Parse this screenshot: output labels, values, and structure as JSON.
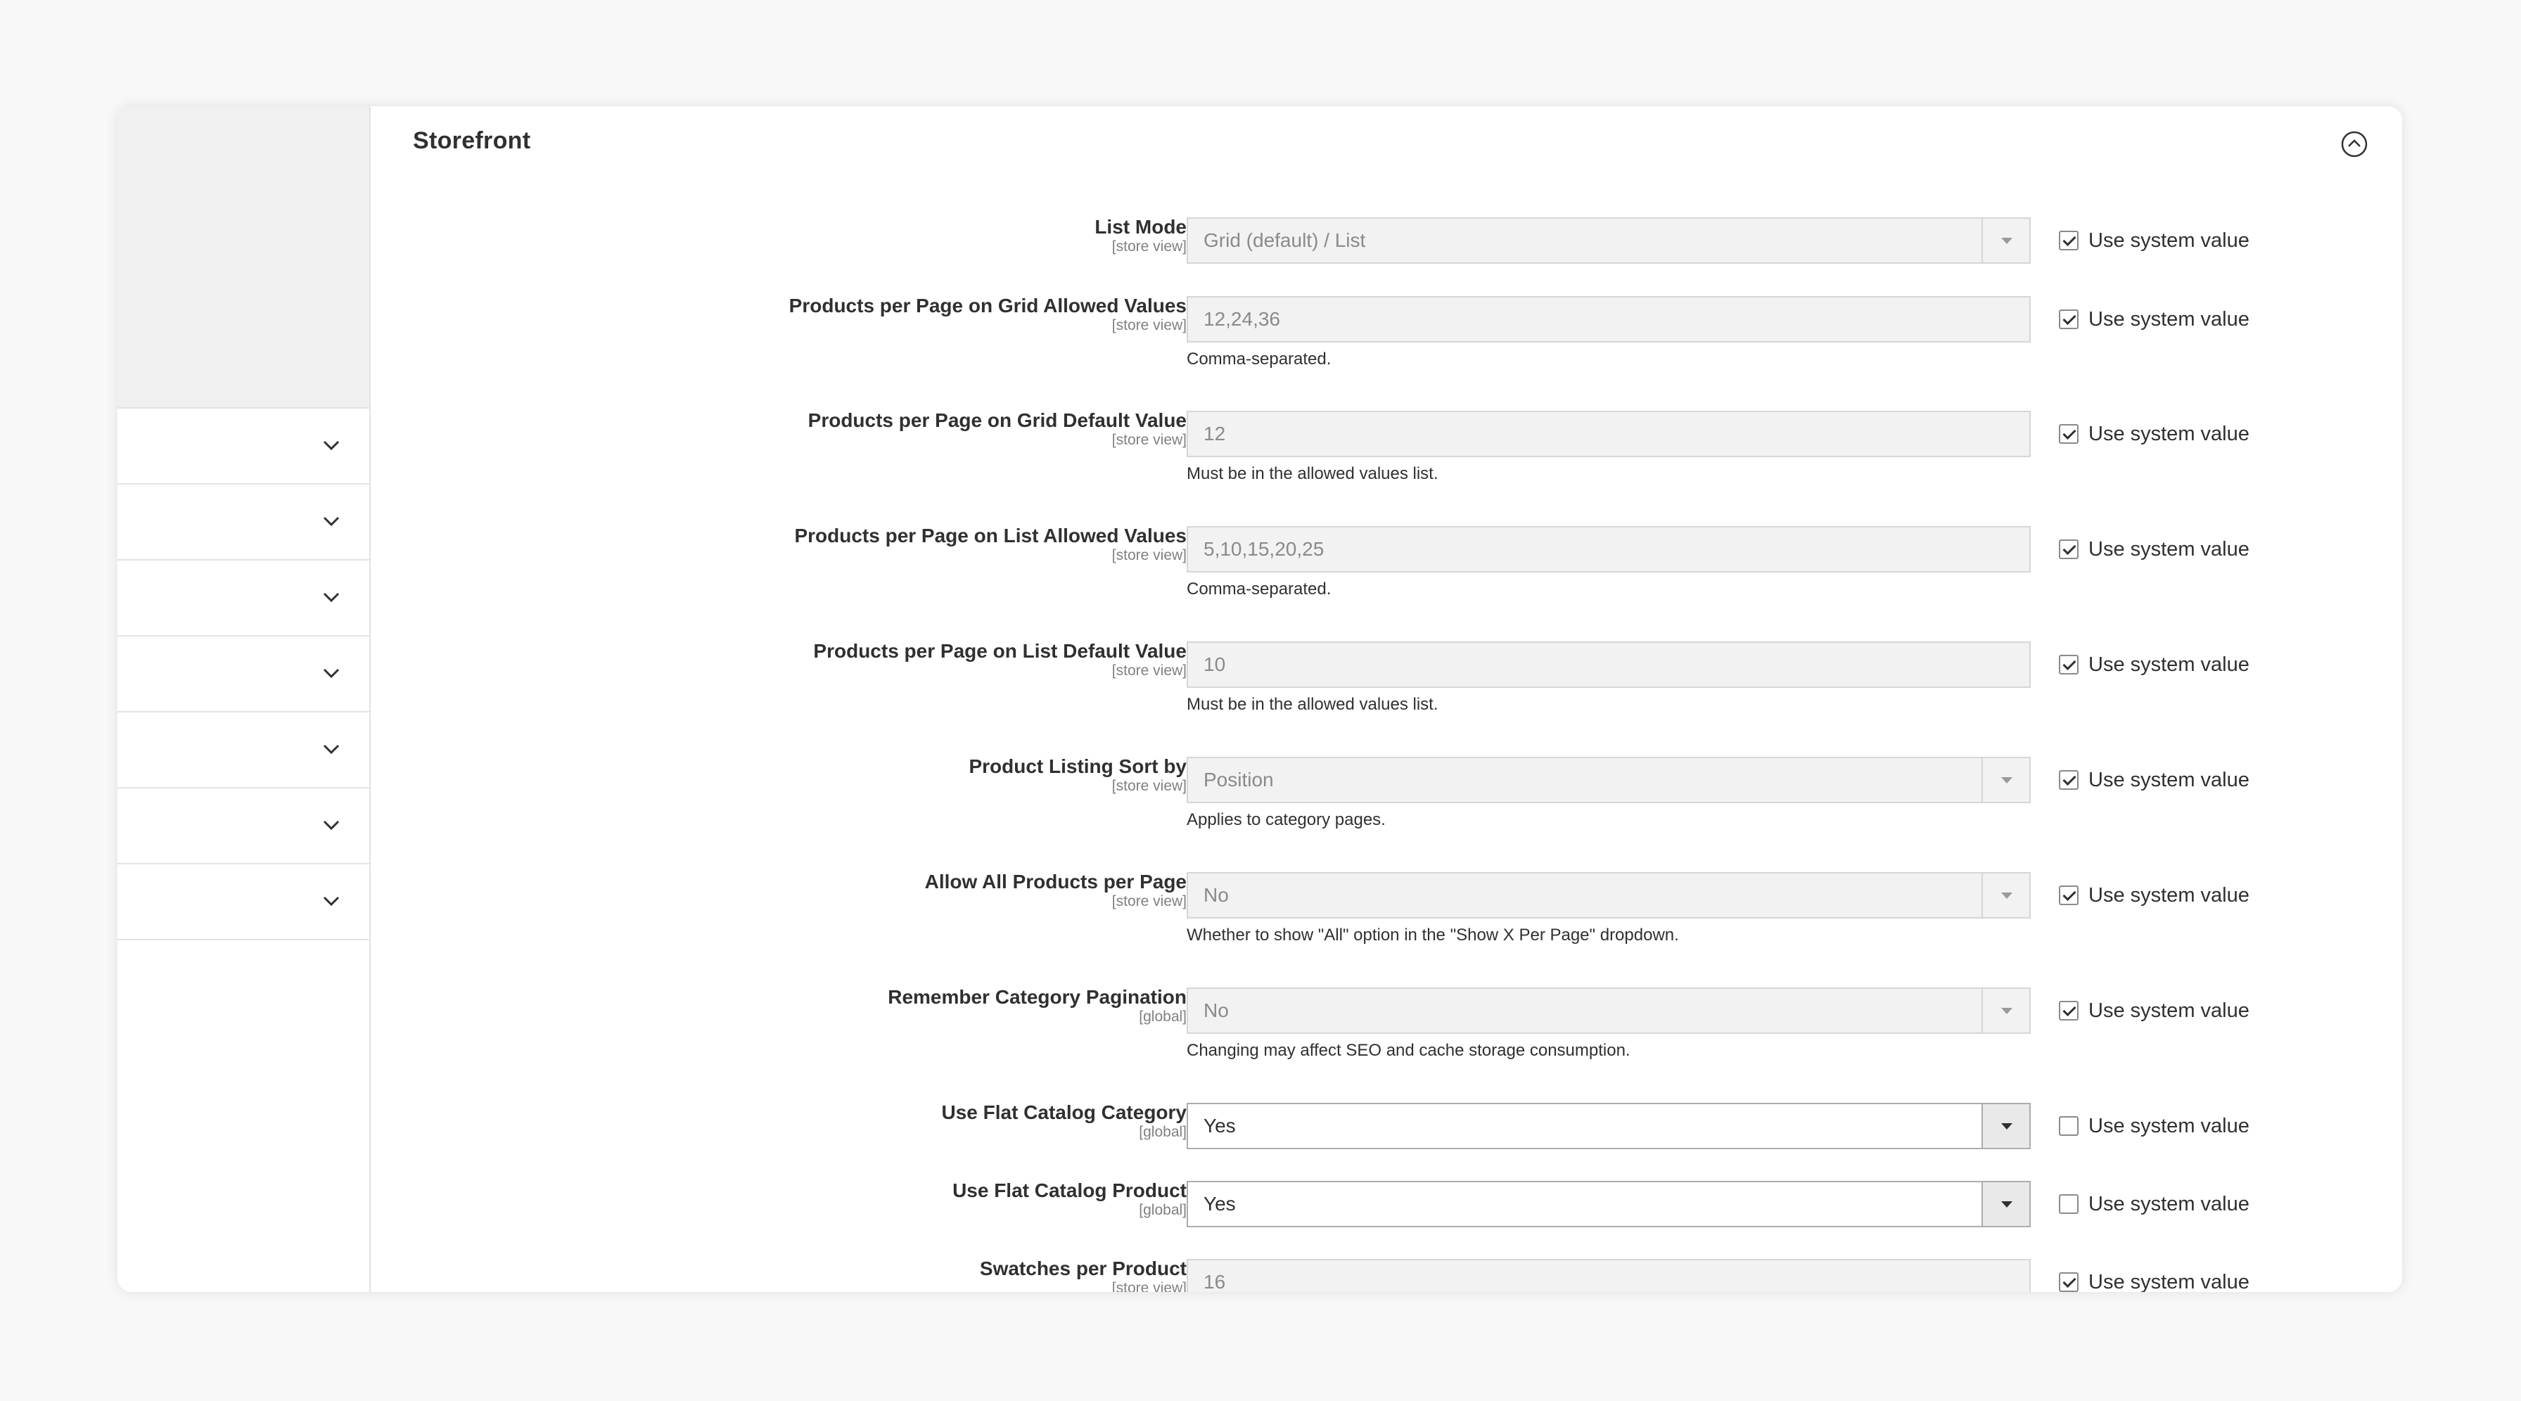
{
  "section": {
    "title": "Storefront"
  },
  "system_value_label": "Use system value",
  "fields": [
    {
      "label": "List Mode",
      "scope": "[store view]",
      "value": "Grid (default) / List",
      "note": "",
      "type": "select",
      "enabled": false,
      "use_system": true
    },
    {
      "label": "Products per Page on Grid Allowed Values",
      "scope": "[store view]",
      "value": "12,24,36",
      "note": "Comma-separated.",
      "type": "text",
      "enabled": false,
      "use_system": true
    },
    {
      "label": "Products per Page on Grid Default Value",
      "scope": "[store view]",
      "value": "12",
      "note": "Must be in the allowed values list.",
      "type": "text",
      "enabled": false,
      "use_system": true
    },
    {
      "label": "Products per Page on List Allowed Values",
      "scope": "[store view]",
      "value": "5,10,15,20,25",
      "note": "Comma-separated.",
      "type": "text",
      "enabled": false,
      "use_system": true
    },
    {
      "label": "Products per Page on List Default Value",
      "scope": "[store view]",
      "value": "10",
      "note": "Must be in the allowed values list.",
      "type": "text",
      "enabled": false,
      "use_system": true
    },
    {
      "label": "Product Listing Sort by",
      "scope": "[store view]",
      "value": "Position",
      "note": "Applies to category pages.",
      "type": "select",
      "enabled": false,
      "use_system": true
    },
    {
      "label": "Allow All Products per Page",
      "scope": "[store view]",
      "value": "No",
      "note": "Whether to show \"All\" option in the \"Show X Per Page\" dropdown.",
      "type": "select",
      "enabled": false,
      "use_system": true
    },
    {
      "label": "Remember Category Pagination",
      "scope": "[global]",
      "value": "No",
      "note": "Changing may affect SEO and cache storage consumption.",
      "type": "select",
      "enabled": false,
      "use_system": true
    },
    {
      "label": "Use Flat Catalog Category",
      "scope": "[global]",
      "value": "Yes",
      "note": "",
      "type": "select",
      "enabled": true,
      "use_system": false
    },
    {
      "label": "Use Flat Catalog Product",
      "scope": "[global]",
      "value": "Yes",
      "note": "",
      "type": "select",
      "enabled": true,
      "use_system": false
    },
    {
      "label": "Swatches per Product",
      "scope": "[store view]",
      "value": "16",
      "note": "",
      "type": "text",
      "enabled": false,
      "use_system": true
    }
  ]
}
